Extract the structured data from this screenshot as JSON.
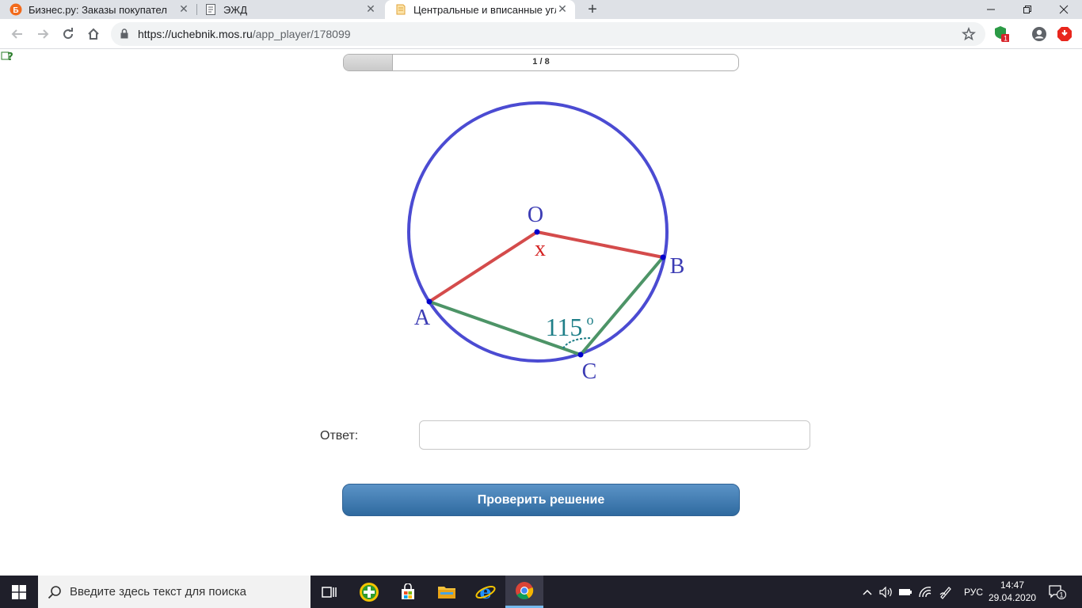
{
  "browser": {
    "tabs": [
      {
        "title": "Бизнес.ру: Заказы покупателей",
        "favicon_letter": "Б"
      },
      {
        "title": "ЭЖД"
      },
      {
        "title": "Центральные и вписанные углы"
      }
    ],
    "url_host": "https://uchebnik.mos.ru",
    "url_path": "/app_player/178099",
    "extension_badge": "1"
  },
  "task": {
    "progress_text": "1 / 8",
    "progress_value": 0.125,
    "figure": {
      "label_O": "O",
      "label_A": "A",
      "label_B": "B",
      "label_C": "C",
      "label_x": "x",
      "angle_label": "115",
      "degree_mark": "o",
      "colors": {
        "circle": "#4b4bd2",
        "radius": "#d44b4b",
        "chord": "#4d9467",
        "angle_text": "#1f7f88",
        "labels": "#3c3cb4",
        "x": "#d42020"
      }
    },
    "answer_label": "Ответ:",
    "answer_value": "",
    "check_button": "Проверить решение"
  },
  "taskbar": {
    "search_placeholder": "Введите здесь текст для поиска",
    "language": "РУС",
    "time": "14:47",
    "date": "29.04.2020",
    "notification_count": "1"
  }
}
